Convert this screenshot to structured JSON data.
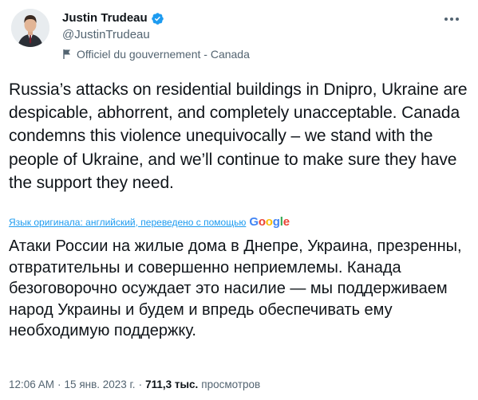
{
  "author": {
    "name": "Justin Trudeau",
    "handle": "@JustinTrudeau",
    "label": "Officiel du gouvernement - Canada",
    "verified_color": "#1d9bf0"
  },
  "tweet": {
    "text": "Russia’s attacks on residential buildings in Dnipro, Ukraine are despicable, abhorrent, and completely unacceptable. Canada condemns this violence unequivocally – we stand with the people of Ukraine, and we’ll continue to make sure they have the support they need.",
    "translation_note": "Язык оригинала: английский, переведено с помощью",
    "translation_provider": "Google",
    "translated_text": "Атаки России на жилые дома в Днепре, Украина, презренны, отвратительны и совершенно неприемлемы. Канада безоговорочно осуждает это насилие — мы поддерживаем народ Украины и будем и впредь обеспечивать ему необходимую поддержку."
  },
  "meta": {
    "time": "12:06 AM",
    "separator": "·",
    "date": "15 янв. 2023 г.",
    "views_count": "711,3 тыс.",
    "views_label": "просмотров"
  },
  "icons": {
    "verified": "verified-badge-icon",
    "flag": "government-flag-icon",
    "more": "more-options-icon"
  }
}
